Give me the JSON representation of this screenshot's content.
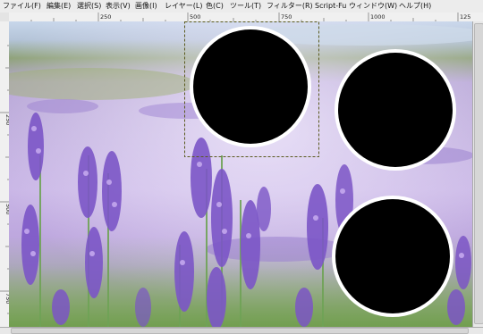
{
  "menu": {
    "items": [
      {
        "label": "ファイル(F)"
      },
      {
        "label": "編集(E)"
      },
      {
        "label": "選択(S)"
      },
      {
        "label": "表示(V)"
      },
      {
        "label": "画像(I)"
      },
      {
        "label": "レイヤー(L)"
      },
      {
        "label": "色(C)"
      },
      {
        "label": "ツール(T)"
      },
      {
        "label": "フィルター(R)"
      },
      {
        "label": "Script-Fu"
      },
      {
        "label": "ウィンドウ(W)"
      },
      {
        "label": "ヘルプ(H)"
      }
    ]
  },
  "ruler": {
    "h_labels": [
      "250",
      "500",
      "750",
      "1000",
      "125"
    ],
    "v_labels": [
      "250",
      "500",
      "750"
    ]
  },
  "canvas": {
    "circle_color": "#000000",
    "ring_color": "#ffffff",
    "selection_color": "#5a5a1e"
  }
}
